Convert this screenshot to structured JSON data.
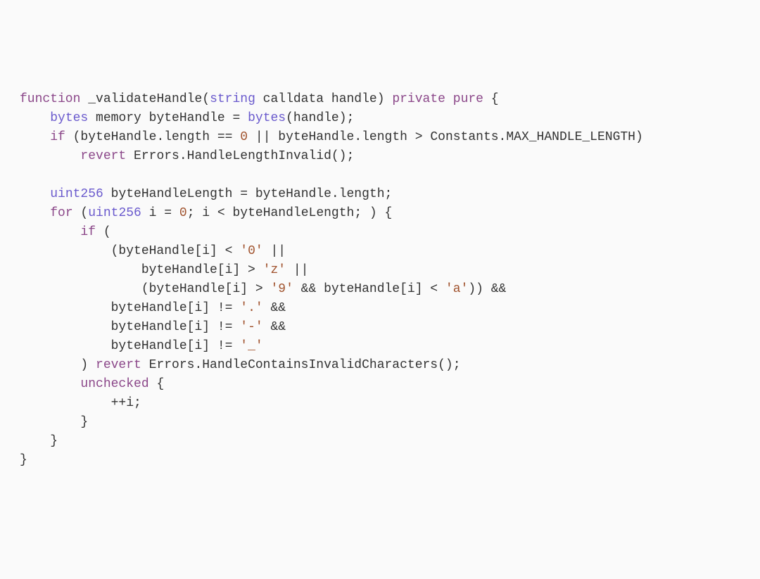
{
  "code": {
    "t1_function": "function",
    "t1_name": " _validateHandle",
    "t1_open": "(",
    "t1_string": "string",
    "t1_calldata": " calldata ",
    "t1_param": "handle",
    "t1_close": ") ",
    "t1_private": "private",
    "t1_space": " ",
    "t1_pure": "pure",
    "t1_brace": " {",
    "t2_indent": "    ",
    "t2_bytes": "bytes",
    "t2_memory": " memory ",
    "t2_var": "byteHandle = ",
    "t2_bytes2": "bytes",
    "t2_call": "(handle);",
    "t3_indent": "    ",
    "t3_if": "if",
    "t3_cond": " (byteHandle.length == ",
    "t3_zero": "0",
    "t3_or": " || byteHandle.length > Constants.MAX_HANDLE_LENGTH)",
    "t4_indent": "        ",
    "t4_revert": "revert",
    "t4_err": " Errors.HandleLengthInvalid();",
    "t5_blank": "",
    "t6_indent": "    ",
    "t6_uint": "uint256",
    "t6_rest": " byteHandleLength = byteHandle.length;",
    "t7_indent": "    ",
    "t7_for": "for",
    "t7_open": " (",
    "t7_uint": "uint256",
    "t7_init": " i = ",
    "t7_zero": "0",
    "t7_rest": "; i < byteHandleLength; ) {",
    "t8_indent": "        ",
    "t8_if": "if",
    "t8_open": " (",
    "t9_indent": "            ",
    "t9_a": "(byteHandle[i] < ",
    "t9_ch": "'0'",
    "t9_b": " ||",
    "t10_indent": "                ",
    "t10_a": "byteHandle[i] > ",
    "t10_ch": "'z'",
    "t10_b": " ||",
    "t11_indent": "                ",
    "t11_a": "(byteHandle[i] > ",
    "t11_ch1": "'9'",
    "t11_b": " && byteHandle[i] < ",
    "t11_ch2": "'a'",
    "t11_c": ")) &&",
    "t12_indent": "            ",
    "t12_a": "byteHandle[i] != ",
    "t12_ch": "'.'",
    "t12_b": " &&",
    "t13_indent": "            ",
    "t13_a": "byteHandle[i] != ",
    "t13_ch": "'-'",
    "t13_b": " &&",
    "t14_indent": "            ",
    "t14_a": "byteHandle[i] != ",
    "t14_ch": "'_'",
    "t15_indent": "        ",
    "t15_close": ") ",
    "t15_revert": "revert",
    "t15_err": " Errors.HandleContainsInvalidCharacters();",
    "t16_indent": "        ",
    "t16_unchecked": "unchecked",
    "t16_brace": " {",
    "t17_indent": "            ",
    "t17_inc": "++i;",
    "t18_indent": "        ",
    "t18_brace": "}",
    "t19_indent": "    ",
    "t19_brace": "}",
    "t20_brace": "}"
  }
}
